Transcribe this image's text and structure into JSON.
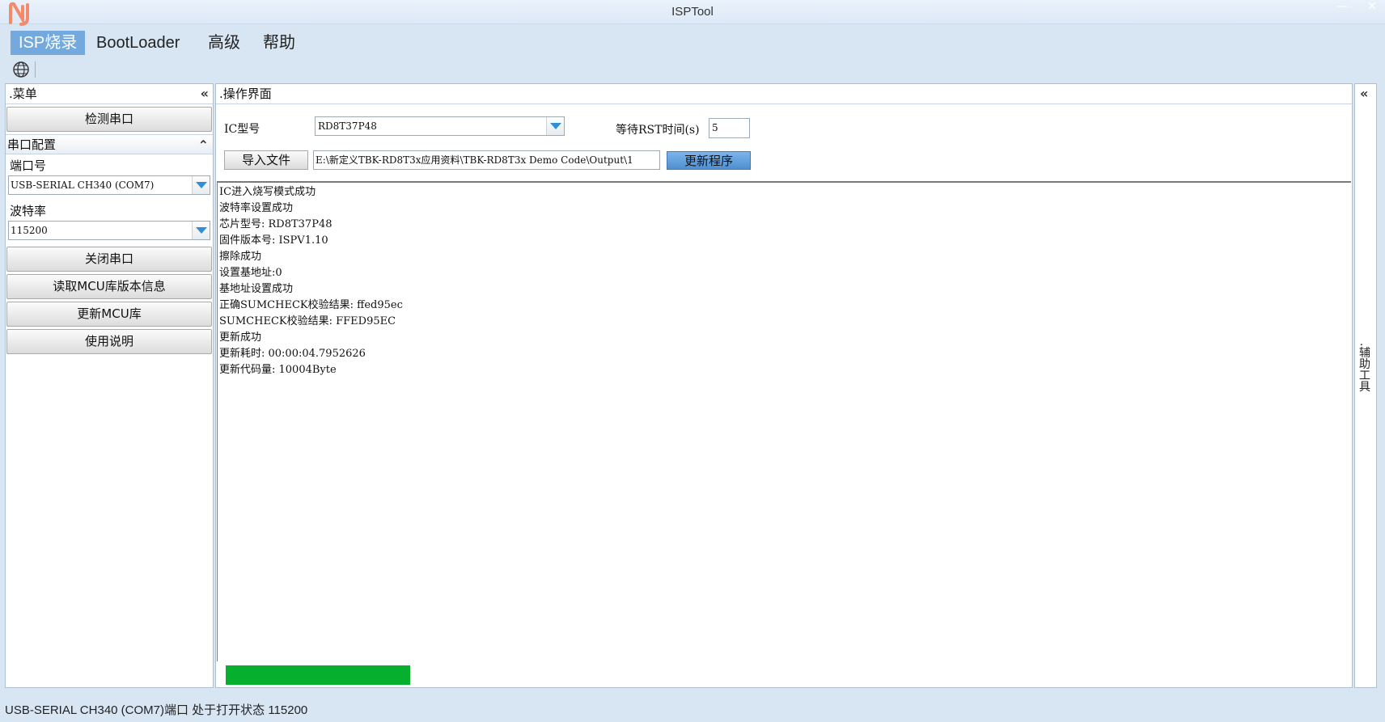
{
  "window": {
    "title": "ISPTool"
  },
  "menu": [
    {
      "label": "ISP烧录",
      "active": true
    },
    {
      "label": "BootLoader"
    },
    {
      "label": "高级"
    },
    {
      "label": "帮助"
    }
  ],
  "left_panel": {
    "header": ".菜单",
    "collapse_glyph": "«",
    "detect_button": "检测串口",
    "section_title": "串口配置",
    "section_glyph": "⌃",
    "port_label": "端口号",
    "port_value": "USB-SERIAL CH340 (COM7)",
    "baud_label": "波特率",
    "baud_value": "115200",
    "close_button": "关闭串口",
    "read_button": "读取MCU库版本信息",
    "update_lib_button": "更新MCU库",
    "help_button": "使用说明"
  },
  "main_panel": {
    "header": ".操作界面",
    "ic_label": "IC型号",
    "ic_value": "RD8T37P48",
    "rst_label": "等待RST时间(s)",
    "rst_value": "5",
    "import_button": "导入文件",
    "file_path": "E:\\新定义TBK-RD8T3x应用资料\\TBK-RD8T3x Demo Code\\Output\\1",
    "update_button": "更新程序",
    "log": [
      "IC进入烧写模式成功",
      "波特率设置成功",
      "芯片型号: RD8T37P48",
      "固件版本号: ISPV1.10",
      "擦除成功",
      "设置基地址:0",
      "基地址设置成功",
      "正确SUMCHECK校验结果: ffed95ec",
      "SUMCHECK校验结果: FFED95EC",
      "更新成功",
      "更新耗时: 00:00:04.7952626",
      "更新代码量: 10004Byte"
    ],
    "progress": 0.165
  },
  "right_strip": {
    "collapse_glyph": "«",
    "label": ".辅助工具"
  },
  "status_bar": "USB-SERIAL CH340 (COM7)端口 处于打开状态 115200",
  "colors": {
    "accent": "#73a9dc",
    "progress": "#06b02e"
  }
}
